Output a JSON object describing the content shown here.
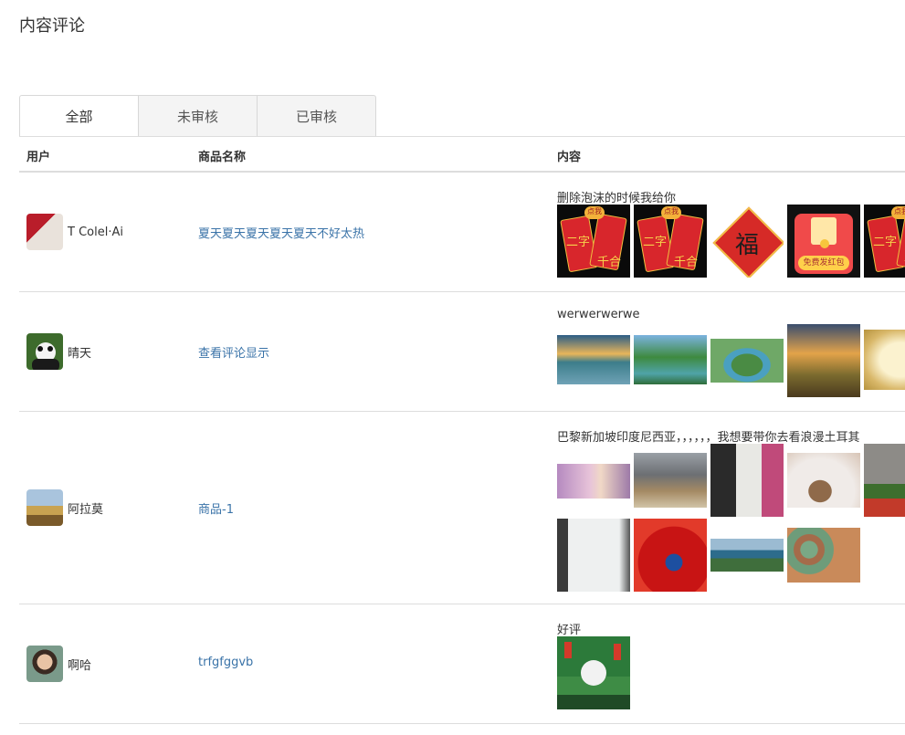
{
  "page": {
    "title": "内容评论"
  },
  "tabs": [
    {
      "label": "全部",
      "active": true
    },
    {
      "label": "未审核",
      "active": false
    },
    {
      "label": "已审核",
      "active": false
    }
  ],
  "table": {
    "headers": {
      "user": "用户",
      "product": "商品名称",
      "content": "内容"
    },
    "rows": [
      {
        "user": "T Colel·Ai",
        "product": "夏天夏天夏天夏天夏天不好太热",
        "content": "删除泡沫的时候我给你",
        "image_count": 5,
        "image_text": {
          "envelope_top": "点我",
          "envelope_mid": "二字",
          "envelope_low": "千合",
          "fu": "福",
          "hongbao": "免费发红包"
        }
      },
      {
        "user": "晴天",
        "product": "查看评论显示",
        "content": "werwerwerwe",
        "image_count": 5
      },
      {
        "user": "阿拉莫",
        "product": "商品-1",
        "content": "巴黎新加坡印度尼西亚，，，，，，我想要带你去看浪漫土耳其",
        "image_count": 9
      },
      {
        "user": "啊哈",
        "product": "trfgfggvb",
        "content": "好评",
        "image_count": 1
      }
    ]
  },
  "colors": {
    "link": "#3a73a8",
    "border": "#dddddd",
    "tab_bg": "#f4f4f4"
  }
}
